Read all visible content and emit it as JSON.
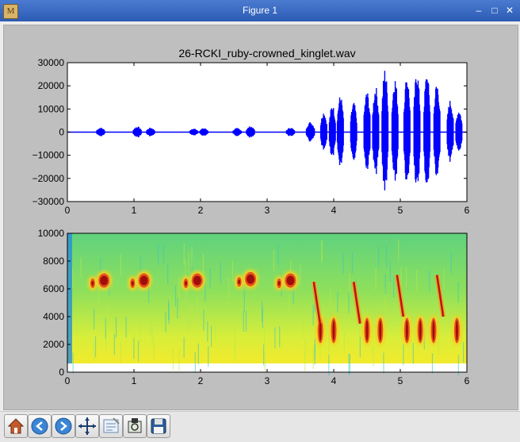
{
  "window": {
    "title": "Figure 1",
    "minimize_glyph": "–",
    "maximize_glyph": "□",
    "close_glyph": "✕",
    "icon": "matplotlib-icon"
  },
  "plot1_title": "26-RCKI_ruby-crowned_kinglet.wav",
  "toolbar": {
    "buttons": [
      "home-icon",
      "back-icon",
      "forward-icon",
      "pan-icon",
      "configure-subplots-icon",
      "zoom-to-rect-icon",
      "save-icon"
    ]
  },
  "chart_data": [
    {
      "type": "line",
      "title": "26-RCKI_ruby-crowned_kinglet.wav",
      "xlim": [
        0,
        6
      ],
      "ylim": [
        -30000,
        30000
      ],
      "x_ticks": [
        "0",
        "1",
        "2",
        "3",
        "4",
        "5",
        "6"
      ],
      "y_ticks": [
        "30000",
        "20000",
        "10000",
        "0",
        "−10000",
        "−20000",
        "−30000"
      ],
      "series_color": "#0000ff",
      "bursts": [
        {
          "t": 0.5,
          "amp": 2000
        },
        {
          "t": 1.05,
          "amp": 2500
        },
        {
          "t": 1.25,
          "amp": 2000
        },
        {
          "t": 1.9,
          "amp": 1600
        },
        {
          "t": 2.05,
          "amp": 1800
        },
        {
          "t": 2.55,
          "amp": 1800
        },
        {
          "t": 2.75,
          "amp": 2600
        },
        {
          "t": 3.35,
          "amp": 2000
        },
        {
          "t": 3.65,
          "amp": 4500
        },
        {
          "t": 3.85,
          "amp": 9000
        },
        {
          "t": 3.98,
          "amp": 12000
        },
        {
          "t": 4.1,
          "amp": 16000
        },
        {
          "t": 4.3,
          "amp": 13000
        },
        {
          "t": 4.5,
          "amp": 18000
        },
        {
          "t": 4.63,
          "amp": 20000
        },
        {
          "t": 4.77,
          "amp": 28000
        },
        {
          "t": 4.92,
          "amp": 24000
        },
        {
          "t": 5.1,
          "amp": 25000
        },
        {
          "t": 5.25,
          "amp": 27000
        },
        {
          "t": 5.4,
          "amp": 26000
        },
        {
          "t": 5.55,
          "amp": 22000
        },
        {
          "t": 5.75,
          "amp": 14000
        },
        {
          "t": 5.88,
          "amp": 10000
        }
      ],
      "grid": false
    },
    {
      "type": "heatmap",
      "xlim": [
        0,
        6
      ],
      "ylim": [
        0,
        10000
      ],
      "x_ticks": [
        "0",
        "1",
        "2",
        "3",
        "4",
        "5",
        "6"
      ],
      "y_ticks": [
        "10000",
        "8000",
        "6000",
        "4000",
        "2000",
        "0"
      ],
      "colormap": "jet",
      "high_syllables": [
        {
          "t": 0.5,
          "f": 6600
        },
        {
          "t": 1.1,
          "f": 6600
        },
        {
          "t": 1.9,
          "f": 6600
        },
        {
          "t": 2.7,
          "f": 6700
        },
        {
          "t": 3.3,
          "f": 6600
        }
      ],
      "low_syllables": [
        {
          "t": 3.8,
          "f": 3000
        },
        {
          "t": 4.0,
          "f": 3000
        },
        {
          "t": 4.5,
          "f": 3000
        },
        {
          "t": 4.7,
          "f": 3000
        },
        {
          "t": 5.1,
          "f": 3000
        },
        {
          "t": 5.3,
          "f": 3000
        },
        {
          "t": 5.5,
          "f": 3000
        },
        {
          "t": 5.85,
          "f": 3000
        }
      ],
      "sweeps": [
        {
          "t": 3.7,
          "f": 5000
        },
        {
          "t": 4.3,
          "f": 5000
        },
        {
          "t": 4.95,
          "f": 5500
        },
        {
          "t": 5.55,
          "f": 5500
        }
      ]
    }
  ]
}
